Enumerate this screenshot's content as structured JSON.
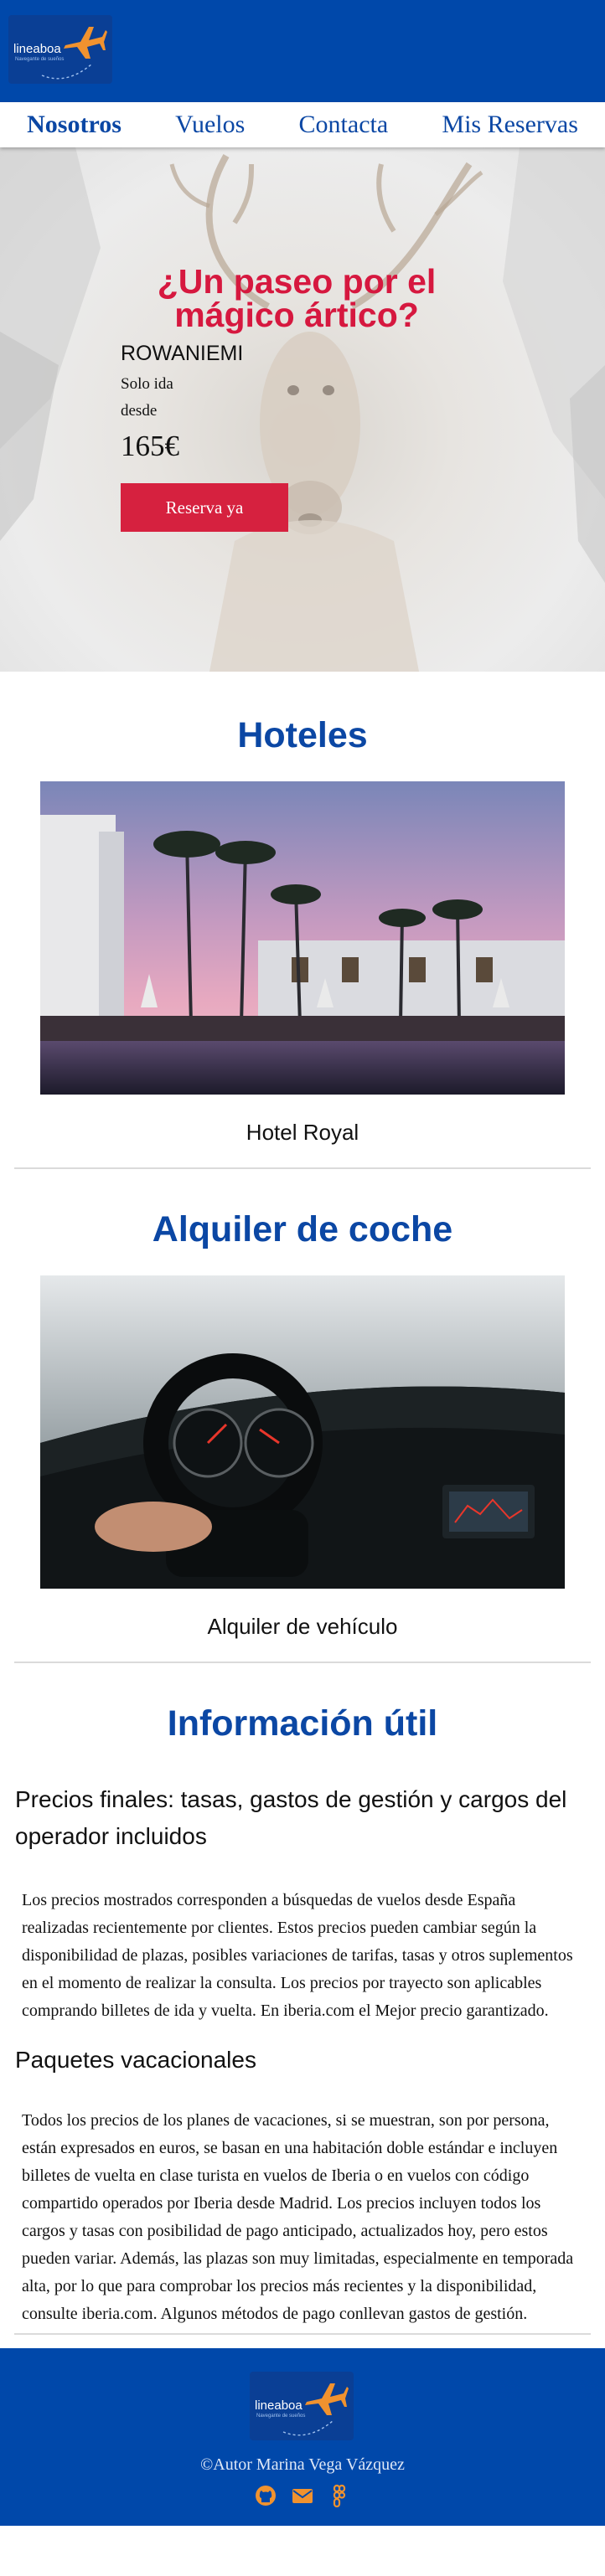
{
  "brand": {
    "name": "lineaboa",
    "tagline": "Navegante de sueños",
    "colors": {
      "primary": "#0048aa",
      "accent": "#f0922f",
      "cta": "#d6213f"
    }
  },
  "nav": {
    "items": [
      {
        "label": "Nosotros",
        "active": true
      },
      {
        "label": "Vuelos",
        "active": false
      },
      {
        "label": "Contacta",
        "active": false
      },
      {
        "label": "Mis Reservas",
        "active": false
      }
    ]
  },
  "hero": {
    "title": "¿Un paseo por el mágico ártico?",
    "city": "ROWANIEMI",
    "trip_type": "Solo ida",
    "from_label": "desde",
    "price": "165€",
    "cta": "Reserva ya"
  },
  "hotels": {
    "title": "Hoteles",
    "caption": "Hotel Royal"
  },
  "cars": {
    "title": "Alquiler de coche",
    "caption": "Alquiler de vehículo"
  },
  "info": {
    "title": "Información útil",
    "blocks": [
      {
        "heading": "Precios finales: tasas, gastos de gestión y cargos del operador incluidos",
        "text": "Los precios mostrados corresponden a búsquedas de vuelos desde España realizadas recientemente por clientes. Estos precios pueden cambiar según la disponibilidad de plazas, posibles variaciones de tarifas, tasas y otros suplementos en el momento de realizar la consulta. Los precios por trayecto son aplicables comprando billetes de ida y vuelta. En iberia.com el Mejor precio garantizado."
      },
      {
        "heading": "Paquetes vacacionales",
        "text": "Todos los precios de los planes de vacaciones, si se muestran, son por persona, están expresados en euros, se basan en una habitación doble estándar e incluyen billetes de vuelta en clase turista en vuelos de Iberia o en vuelos con código compartido operados por Iberia desde Madrid. Los precios incluyen todos los cargos y tasas con posibilidad de pago anticipado, actualizados hoy, pero estos pueden variar. Además, las plazas son muy limitadas, especialmente en temporada alta, por lo que para comprobar los precios más recientes y la disponibilidad, consulte iberia.com. Algunos métodos de pago conllevan gastos de gestión."
      }
    ]
  },
  "footer": {
    "copyright": "©Autor Marina Vega Vázquez",
    "social_icons": [
      "github-icon",
      "mail-icon",
      "figma-icon"
    ]
  }
}
